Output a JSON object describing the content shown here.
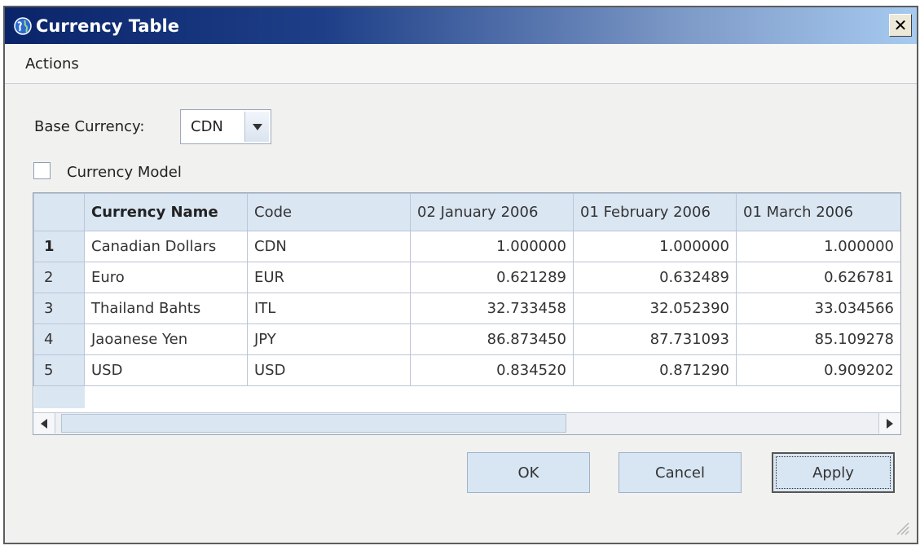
{
  "window": {
    "title": "Currency Table",
    "close_label": "✕"
  },
  "menu": {
    "items": [
      {
        "label": "Actions"
      }
    ]
  },
  "form": {
    "base_currency_label": "Base Currency:",
    "base_currency_value": "CDN",
    "currency_model_label": "Currency Model",
    "currency_model_checked": false
  },
  "table": {
    "columns": [
      "Currency Name",
      "Code",
      "02 January 2006",
      "01 February 2006",
      "01 March 2006"
    ],
    "rows": [
      {
        "num": "1",
        "name": "Canadian Dollars",
        "code": "CDN",
        "v1": "1.000000",
        "v2": "1.000000",
        "v3": "1.000000"
      },
      {
        "num": "2",
        "name": "Euro",
        "code": "EUR",
        "v1": "0.621289",
        "v2": "0.632489",
        "v3": "0.626781"
      },
      {
        "num": "3",
        "name": "Thailand Bahts",
        "code": "ITL",
        "v1": "32.733458",
        "v2": "32.052390",
        "v3": "33.034566"
      },
      {
        "num": "4",
        "name": "Jaoanese Yen",
        "code": "JPY",
        "v1": "86.873450",
        "v2": "87.731093",
        "v3": "85.109278"
      },
      {
        "num": "5",
        "name": "USD",
        "code": "USD",
        "v1": "0.834520",
        "v2": "0.871290",
        "v3": "0.909202"
      }
    ]
  },
  "buttons": {
    "ok": "OK",
    "cancel": "Cancel",
    "apply": "Apply"
  },
  "colors": {
    "titlebar_start": "#0a246a",
    "titlebar_end": "#a6caf0",
    "header_bg": "#dbe6f3",
    "button_bg": "#d8e5f3"
  },
  "icons": {
    "title": "globe-icon",
    "dropdown": "triangle-down-icon",
    "scroll_left": "triangle-left-icon",
    "scroll_right": "triangle-right-icon"
  }
}
